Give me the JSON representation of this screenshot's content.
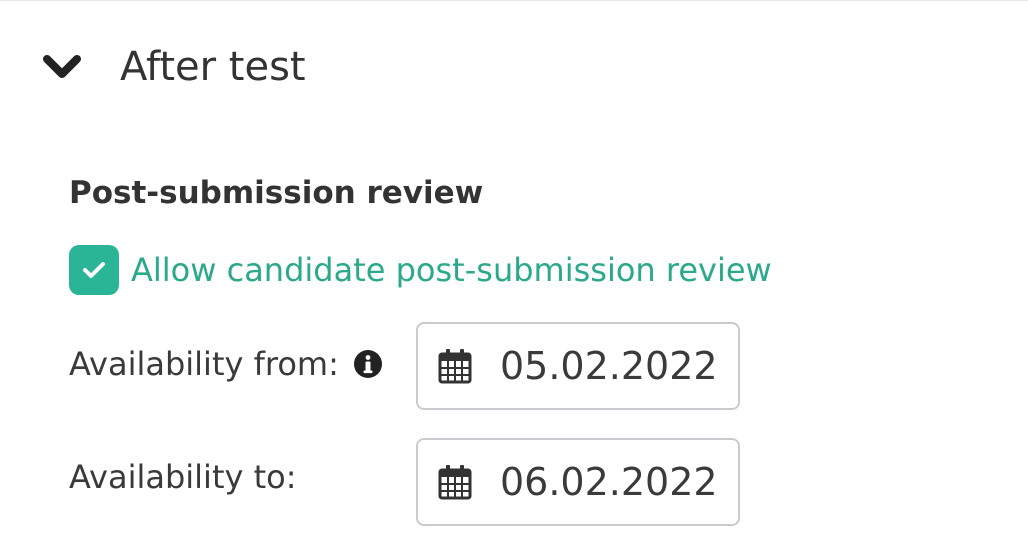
{
  "section": {
    "title": "After test",
    "expanded_icon": "chevron-down-icon"
  },
  "review": {
    "group_label": "Post-submission review",
    "checkbox_label": "Allow candidate post-submission review",
    "checkbox_checked": true,
    "accent_color": "#2bb597"
  },
  "availability_from": {
    "label": "Availability from:",
    "info_icon": "info-icon",
    "value": "05.02.2022",
    "icon": "calendar-icon"
  },
  "availability_to": {
    "label": "Availability to:",
    "value": "06.02.2022",
    "icon": "calendar-icon"
  }
}
